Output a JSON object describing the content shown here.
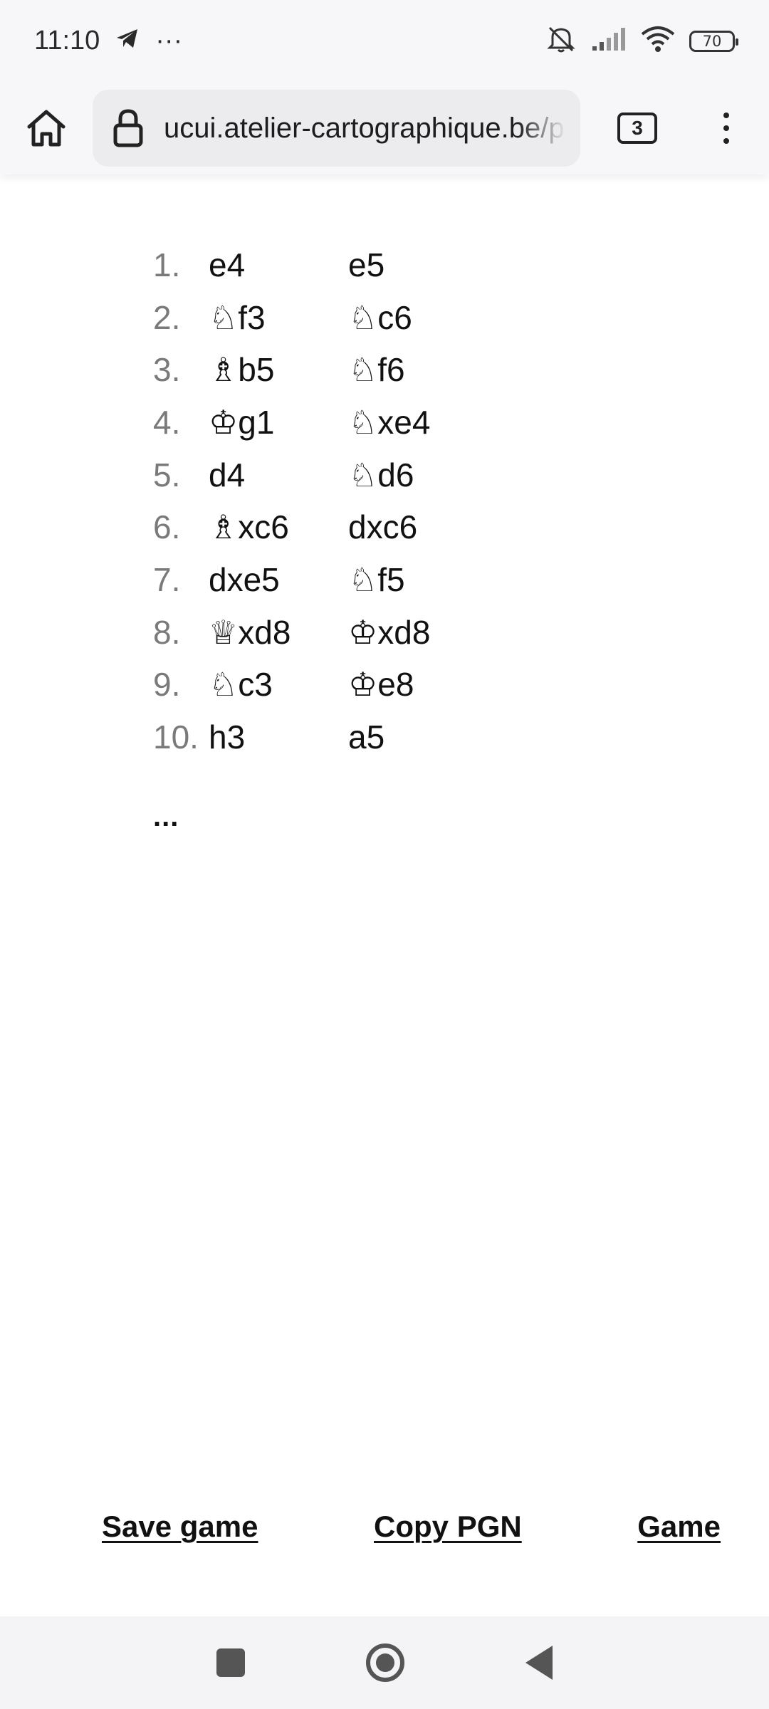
{
  "status": {
    "time": "11:10",
    "extra": "···",
    "battery": "70"
  },
  "browser": {
    "url": "ucui.atelier-cartographique.be/play",
    "tab_count": "3"
  },
  "moves": [
    {
      "num": "1.",
      "white": "e4",
      "black": "e5"
    },
    {
      "num": "2.",
      "white": "♘f3",
      "black": "♘c6"
    },
    {
      "num": "3.",
      "white": "♗b5",
      "black": "♘f6"
    },
    {
      "num": "4.",
      "white": "♔g1",
      "black": "♘xe4"
    },
    {
      "num": "5.",
      "white": "d4",
      "black": "♘d6"
    },
    {
      "num": "6.",
      "white": "♗xc6",
      "black": "dxc6"
    },
    {
      "num": "7.",
      "white": "dxe5",
      "black": "♘f5"
    },
    {
      "num": "8.",
      "white": "♕xd8",
      "black": "♔xd8"
    },
    {
      "num": "9.",
      "white": "♘c3",
      "black": "♔e8"
    },
    {
      "num": "10.",
      "white": "h3",
      "black": "a5"
    }
  ],
  "ellipsis": "...",
  "links": {
    "save": "Save game",
    "copy": "Copy PGN",
    "game": "Game"
  }
}
